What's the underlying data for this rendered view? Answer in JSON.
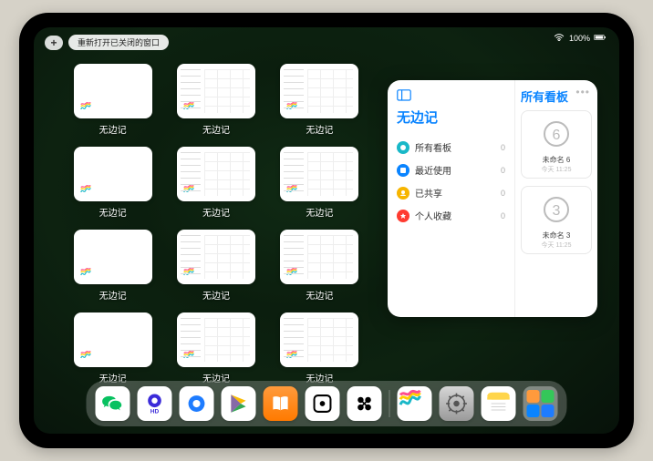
{
  "status": {
    "battery": "100%"
  },
  "topbar": {
    "plus": "+",
    "reopen_label": "重新打开已关闭的窗口"
  },
  "app_name": "无边记",
  "cards": [
    {
      "label": "无边记",
      "cal": false
    },
    {
      "label": "无边记",
      "cal": true
    },
    {
      "label": "无边记",
      "cal": true
    },
    {
      "label": "无边记",
      "cal": false
    },
    {
      "label": "无边记",
      "cal": true
    },
    {
      "label": "无边记",
      "cal": true
    },
    {
      "label": "无边记",
      "cal": false
    },
    {
      "label": "无边记",
      "cal": true
    },
    {
      "label": "无边记",
      "cal": true
    },
    {
      "label": "无边记",
      "cal": false
    },
    {
      "label": "无边记",
      "cal": true
    },
    {
      "label": "无边记",
      "cal": true
    }
  ],
  "panel": {
    "title": "无边记",
    "right_title": "所有看板",
    "items": [
      {
        "label": "所有看板",
        "count": "0",
        "color": "#19b8c8"
      },
      {
        "label": "最近使用",
        "count": "0",
        "color": "#0a84ff"
      },
      {
        "label": "已共享",
        "count": "0",
        "color": "#f7b500"
      },
      {
        "label": "个人收藏",
        "count": "0",
        "color": "#ff3b30"
      }
    ],
    "boards": [
      {
        "title": "未命名 6",
        "date": "今天 11:25",
        "glyph": "6"
      },
      {
        "title": "未命名 3",
        "date": "今天 11:25",
        "glyph": "3"
      }
    ]
  },
  "dock": [
    {
      "name": "wechat",
      "bg": "#ffffff"
    },
    {
      "name": "quark-hd",
      "bg": "#ffffff"
    },
    {
      "name": "quark",
      "bg": "#ffffff"
    },
    {
      "name": "play",
      "bg": "#ffffff"
    },
    {
      "name": "books",
      "bg": "linear-gradient(#ff9a3c,#ff7a00)"
    },
    {
      "name": "dice",
      "bg": "#ffffff"
    },
    {
      "name": "spectrum",
      "bg": "#ffffff"
    },
    {
      "name": "freeform",
      "bg": "#ffffff"
    },
    {
      "name": "settings",
      "bg": "linear-gradient(#d6d6d6,#9a9a9a)"
    },
    {
      "name": "notes",
      "bg": "#ffffff"
    }
  ]
}
